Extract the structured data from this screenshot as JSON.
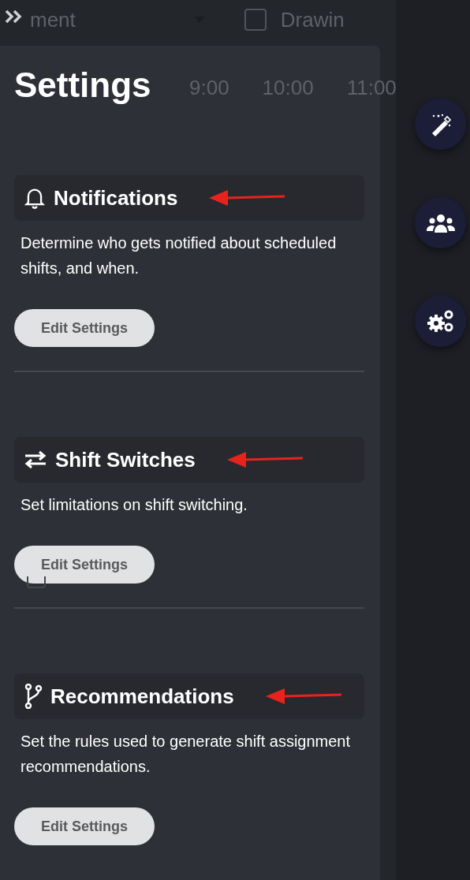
{
  "background_app": {
    "toolbar": {
      "filter_value": "ment",
      "checkbox": {
        "checked": false
      },
      "label": "Drawin"
    },
    "time_labels": [
      "9:00",
      "10:00",
      "11:00"
    ],
    "row_checkbox": {
      "checked": false
    }
  },
  "settings_panel": {
    "title": "Settings",
    "sections": [
      {
        "title": "Notifications",
        "description": "Determine who gets notified about scheduled shifts, and when.",
        "button": "Edit Settings",
        "annotated": true
      },
      {
        "title": "Shift Switches",
        "description": "Set limitations on shift switching.",
        "button": "Edit Settings",
        "annotated": true
      },
      {
        "title": "Recommendations",
        "description": "Set the rules used to generate shift assignment recommendations.",
        "button": "Edit Settings",
        "annotated": true
      }
    ]
  }
}
